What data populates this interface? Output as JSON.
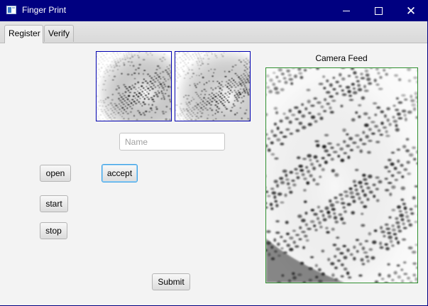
{
  "window": {
    "title": "Finger Print",
    "controls": {
      "minimize": "minimize-icon",
      "maximize": "maximize-icon",
      "close": "close-icon"
    }
  },
  "tabs": [
    {
      "label": "Register",
      "active": true
    },
    {
      "label": "Verify",
      "active": false
    }
  ],
  "register": {
    "thumbnails": [
      "fingerprint-image-1",
      "fingerprint-image-2"
    ],
    "name_placeholder": "Name",
    "name_value": "",
    "buttons": {
      "open": "open",
      "accept": "accept",
      "start": "start",
      "stop": "stop",
      "submit": "Submit"
    },
    "camera_label": "Camera Feed"
  },
  "colors": {
    "titlebar": "#000080",
    "thumbnail_border": "#0000b0",
    "camera_border": "#2f8f2f",
    "focus_ring": "#3aa2e6"
  }
}
